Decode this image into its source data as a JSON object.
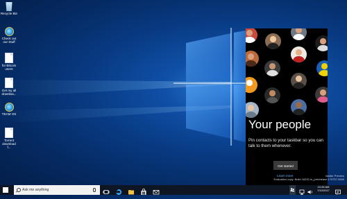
{
  "desktop": {
    "icons": [
      {
        "label": "Recycle Bin"
      },
      {
        "label": "Check out our Stuff"
      },
      {
        "label": "for Bitcoin users"
      },
      {
        "label": "Get my all downloa..."
      },
      {
        "label": "TEAM OS"
      },
      {
        "label": "Torrent download f..."
      }
    ]
  },
  "people_flyout": {
    "title": "Your people",
    "description": "Pin contacts to your taskbar so you can talk to them whenever.",
    "get_started_label": "Get started",
    "learn_more_label": "Learn more"
  },
  "watermark": {
    "line1": "Insider Preview",
    "line2": "Evaluation copy. Build 16232.rs_prerelease.170707-0549"
  },
  "taskbar": {
    "search_placeholder": "Ask me anything",
    "time": "10:26 AM",
    "date": "7/10/2017"
  }
}
